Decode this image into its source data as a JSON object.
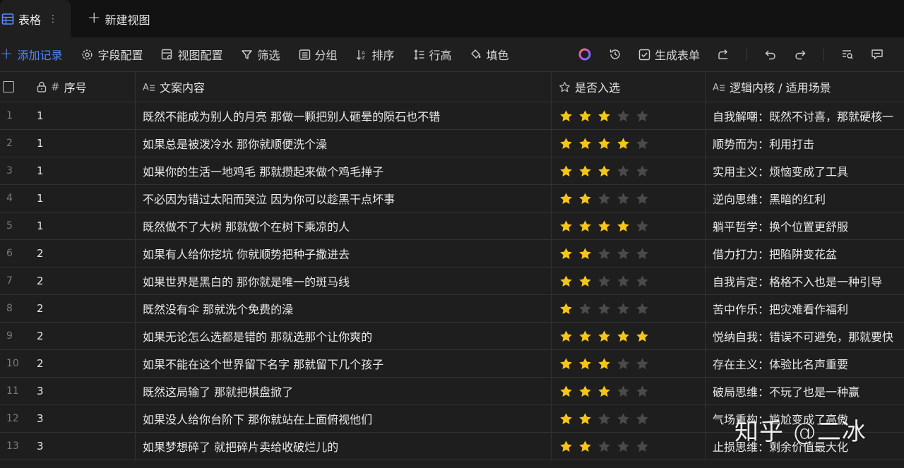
{
  "tabbar": {
    "active_tab": "表格",
    "more": "⋮",
    "new_view": "新建视图"
  },
  "toolbar": {
    "add_record": "添加记录",
    "field_config": "字段配置",
    "view_config": "视图配置",
    "filter": "筛选",
    "group": "分组",
    "sort": "排序",
    "row_height": "行高",
    "fill": "填色",
    "generate_form": "生成表单"
  },
  "columns": {
    "seq": "序号",
    "text": "文案内容",
    "rating": "是否入选",
    "logic": "逻辑内核 / 适用场景"
  },
  "colors": {
    "accent": "#4d85ff",
    "star_on": "#f5c518",
    "star_off": "#4a4a4a"
  },
  "rows": [
    {
      "idx": "1",
      "seq": "1",
      "text": "既然不能成为别人的月亮 那做一颗把别人砸晕的陨石也不错",
      "rating": 3,
      "logic": "自我解嘲：既然不讨喜，那就硬核一"
    },
    {
      "idx": "2",
      "seq": "1",
      "text": "如果总是被泼冷水 那你就顺便洗个澡",
      "rating": 4,
      "logic": "顺势而为：利用打击"
    },
    {
      "idx": "3",
      "seq": "1",
      "text": "如果你的生活一地鸡毛 那就攒起来做个鸡毛掸子",
      "rating": 3,
      "logic": "实用主义：烦恼变成了工具"
    },
    {
      "idx": "4",
      "seq": "1",
      "text": "不必因为错过太阳而哭泣 因为你可以趁黑干点坏事",
      "rating": 2,
      "logic": "逆向思维：黑暗的红利"
    },
    {
      "idx": "5",
      "seq": "1",
      "text": "既然做不了大树 那就做个在树下乘凉的人",
      "rating": 4,
      "logic": "躺平哲学：换个位置更舒服"
    },
    {
      "idx": "6",
      "seq": "2",
      "text": "如果有人给你挖坑 你就顺势把种子撒进去",
      "rating": 2,
      "logic": "借力打力：把陷阱变花盆"
    },
    {
      "idx": "7",
      "seq": "2",
      "text": "如果世界是黑白的 那你就是唯一的斑马线",
      "rating": 2,
      "logic": "自我肯定：格格不入也是一种引导"
    },
    {
      "idx": "8",
      "seq": "2",
      "text": "既然没有伞 那就洗个免费的澡",
      "rating": 1,
      "logic": "苦中作乐：把灾难看作福利"
    },
    {
      "idx": "9",
      "seq": "2",
      "text": "如果无论怎么选都是错的 那就选那个让你爽的",
      "rating": 5,
      "logic": "悦纳自我：错误不可避免，那就要快"
    },
    {
      "idx": "10",
      "seq": "2",
      "text": "如果不能在这个世界留下名字 那就留下几个孩子",
      "rating": 3,
      "logic": "存在主义：体验比名声重要"
    },
    {
      "idx": "11",
      "seq": "3",
      "text": "既然这局输了 那就把棋盘掀了",
      "rating": 3,
      "logic": "破局思维：不玩了也是一种赢"
    },
    {
      "idx": "12",
      "seq": "3",
      "text": "如果没人给你台阶下 那你就站在上面俯视他们",
      "rating": 2,
      "logic": "气场重构：尴尬变成了高傲"
    },
    {
      "idx": "13",
      "seq": "3",
      "text": "如果梦想碎了 就把碎片卖给收破烂儿的",
      "rating": 2,
      "logic": "止损思维：剩余价值最大化"
    }
  ],
  "watermark": "知乎 @二冰"
}
